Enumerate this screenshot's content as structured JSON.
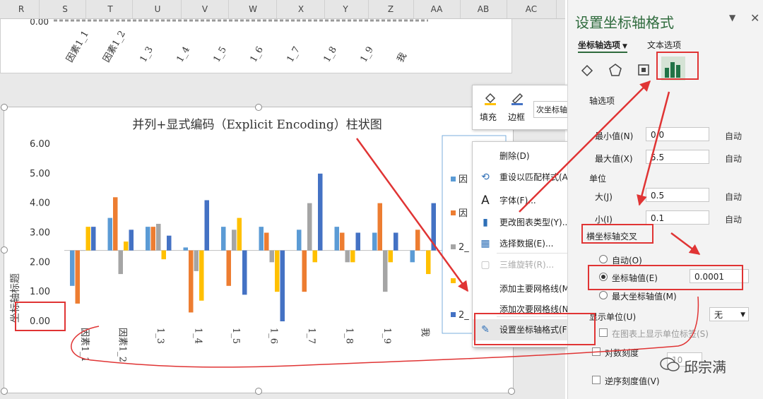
{
  "columns": [
    "R",
    "S",
    "T",
    "U",
    "V",
    "W",
    "X",
    "Y",
    "Z",
    "AA",
    "AB",
    "AC"
  ],
  "top_chart": {
    "y_tick": "0.00",
    "categories": [
      "因素1_1",
      "因素1_2",
      "1_3",
      "1_4",
      "1_5",
      "1_6",
      "1_7",
      "1_8",
      "1_9",
      "我"
    ]
  },
  "chart_data": {
    "type": "bar",
    "title": "并列+显式编码（Explicit Encoding）柱状图",
    "ylabel": "坐标轴标题",
    "xlabel": "",
    "ylim": [
      0,
      6
    ],
    "y_ticks": [
      "6.00",
      "5.00",
      "4.00",
      "3.00",
      "2.00",
      "1.00",
      "0.00"
    ],
    "axis_cross": 2.4,
    "categories": [
      "因素1_1",
      "因素1_2",
      "1_3",
      "1_4",
      "1_5",
      "1_6",
      "1_7",
      "1_8",
      "1_9",
      "我"
    ],
    "series": [
      {
        "name": "因",
        "color": "#5b9bd5",
        "values": [
          1.2,
          3.5,
          3.2,
          2.5,
          3.2,
          3.2,
          3.1,
          3.2,
          3.0,
          2.0
        ]
      },
      {
        "name": "因",
        "color": "#ed7d31",
        "values": [
          0.6,
          4.2,
          3.2,
          0.3,
          1.2,
          3.0,
          1.0,
          3.0,
          4.0,
          3.1
        ]
      },
      {
        "name": "2_",
        "color": "#a5a5a5",
        "values": [
          2.4,
          1.6,
          3.3,
          1.7,
          3.1,
          2.0,
          4.0,
          2.0,
          1.0,
          2.4
        ]
      },
      {
        "name": "",
        "color": "#ffc000",
        "values": [
          3.2,
          2.7,
          2.1,
          0.7,
          3.5,
          1.0,
          2.0,
          2.0,
          2.0,
          1.6
        ]
      },
      {
        "name": "2_",
        "color": "#4472c4",
        "values": [
          3.2,
          3.1,
          2.9,
          4.1,
          0.9,
          0.0,
          5.0,
          3.0,
          3.0,
          4.0
        ]
      }
    ]
  },
  "mini_toolbar": {
    "fill_label": "填充",
    "border_label": "边框",
    "dropdown_value": "次坐标轴 垂直 (值"
  },
  "context_menu": [
    {
      "label": "删除(D)",
      "icon": "none",
      "disabled": false
    },
    {
      "label": "重设以匹配样式(A)",
      "icon": "reset-icon",
      "disabled": false
    },
    {
      "label": "字体(F)...",
      "icon": "font-icon",
      "disabled": false
    },
    {
      "label": "更改图表类型(Y)...",
      "icon": "chart-type-icon",
      "disabled": false
    },
    {
      "label": "选择数据(E)...",
      "icon": "select-data-icon",
      "disabled": false
    },
    {
      "label": "三维旋转(R)...",
      "icon": "3d-rotate-icon",
      "disabled": true
    },
    {
      "label": "添加主要网格线(M)",
      "icon": "none",
      "disabled": false
    },
    {
      "label": "添加次要网格线(N)",
      "icon": "none",
      "disabled": false
    },
    {
      "label": "设置坐标轴格式(F)...",
      "icon": "format-axis-icon",
      "disabled": false
    }
  ],
  "pane": {
    "title": "设置坐标轴格式",
    "tab_axis_options": "坐标轴选项",
    "tab_text_options": "文本选项",
    "section_bounds": "轴选项",
    "min_label": "最小值(N)",
    "min_value": "0.0",
    "max_label": "最大值(X)",
    "max_value": "5.5",
    "units_label": "单位",
    "major_label": "大(J)",
    "major_value": "0.5",
    "minor_label": "小(I)",
    "minor_value": "0.1",
    "auto_label": "自动",
    "cross_section": "横坐标轴交叉",
    "radio_auto": "自动(O)",
    "radio_axis_value": "坐标轴值(E)",
    "axis_value": "0.0001",
    "radio_max": "最大坐标轴值(M)",
    "display_units_label": "显示单位(U)",
    "display_units_value": "无",
    "show_units_label": "在图表上显示单位标签(S)",
    "log_scale_label": "对数刻度",
    "log_base": "10",
    "reverse_label": "逆序刻度值(V)",
    "watermark": "邱宗满"
  }
}
